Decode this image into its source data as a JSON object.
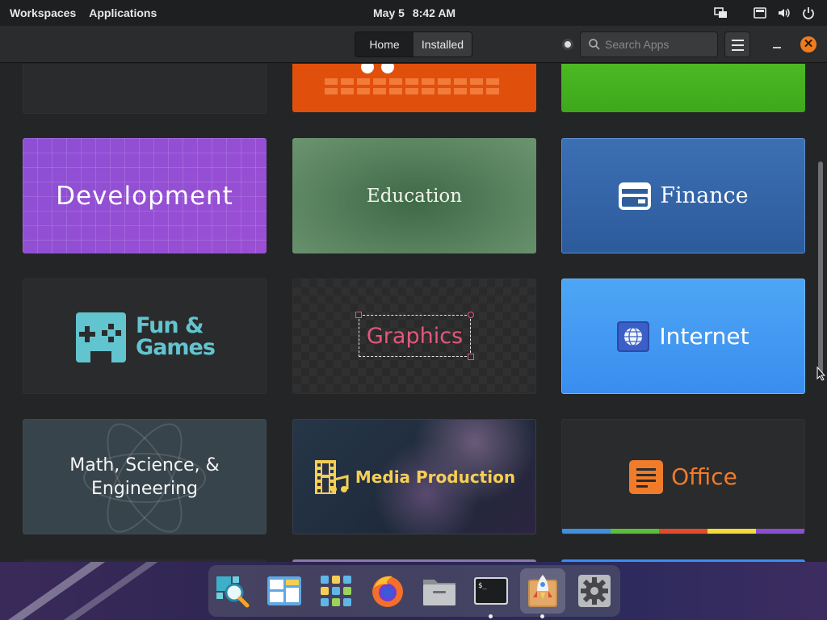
{
  "panel": {
    "workspaces": "Workspaces",
    "applications": "Applications",
    "date": "May 5",
    "time": "8:42 AM"
  },
  "header": {
    "tabs": [
      {
        "label": "Home",
        "active": true
      },
      {
        "label": "Installed",
        "active": false
      }
    ],
    "search_placeholder": "Search Apps"
  },
  "categories": [
    {
      "label": "Development"
    },
    {
      "label": "Education"
    },
    {
      "label": "Finance"
    },
    {
      "label_line1": "Fun &",
      "label_line2": "Games"
    },
    {
      "label": "Graphics"
    },
    {
      "label": "Internet"
    },
    {
      "label_line1": "Math, Science, &",
      "label_line2": "Engineering"
    },
    {
      "label": "Media Production"
    },
    {
      "label": "Office"
    }
  ],
  "colors": {
    "accent_orange": "#f07b1f",
    "development": "#8d4fd4",
    "education": "#5a8560",
    "finance": "#3466aa",
    "fun_games": "#62c4cf",
    "graphics": "#e4577b",
    "internet": "#4a9ef2",
    "media_production": "#f5cf55",
    "office": "#f07b2a",
    "office_stripe": [
      "#3d8fe0",
      "#5bbf3c",
      "#f3bb2c",
      "#e04c2a",
      "#f3da3c",
      "#8a4fd0"
    ]
  },
  "dock": {
    "items": [
      {
        "name": "search-apps",
        "icon": "magnifier-icon",
        "running": false
      },
      {
        "name": "multitasking-view",
        "icon": "windows-icon",
        "running": false
      },
      {
        "name": "app-grid",
        "icon": "grid-icon",
        "running": false
      },
      {
        "name": "firefox",
        "icon": "firefox-icon",
        "running": false
      },
      {
        "name": "files",
        "icon": "folder-icon",
        "running": false
      },
      {
        "name": "terminal",
        "icon": "terminal-icon",
        "running": true
      },
      {
        "name": "app-center",
        "icon": "rocket-icon",
        "running": true
      },
      {
        "name": "settings",
        "icon": "gear-icon",
        "running": false
      }
    ]
  }
}
